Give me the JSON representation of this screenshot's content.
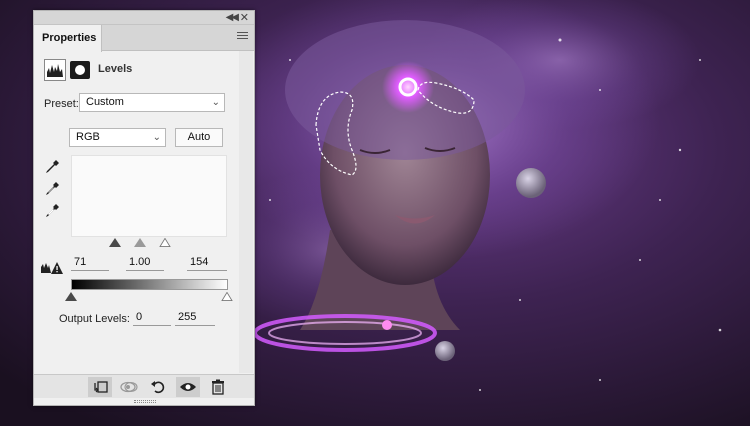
{
  "panel": {
    "tab_label": "Properties",
    "adjustment_title": "Levels",
    "preset_label": "Preset:",
    "preset_value": "Custom",
    "channel_value": "RGB",
    "auto_label": "Auto",
    "input_levels": {
      "shadows": "71",
      "midtones": "1.00",
      "highlights": "154"
    },
    "output_label": "Output Levels:",
    "output_levels": {
      "low": "0",
      "high": "255"
    }
  },
  "icons": {
    "collapse": "double-chevron-icon",
    "close": "close-icon",
    "panel_menu": "hamburger-menu-icon",
    "adjustment": "levels-icon",
    "mask": "mask-icon",
    "eyedroppers": [
      "black-point-eyedropper-icon",
      "gray-point-eyedropper-icon",
      "white-point-eyedropper-icon"
    ],
    "clipping": "clipping-warning-icon",
    "bottom_toolbar": [
      "clip-to-layer-icon",
      "view-previous-state-icon",
      "reset-icon",
      "toggle-visibility-icon",
      "trash-icon"
    ]
  },
  "colors": {
    "panel_bg": "#f0f0f0",
    "tabbar_bg": "#d6d6d6",
    "accent_glow": "#d255ff"
  }
}
